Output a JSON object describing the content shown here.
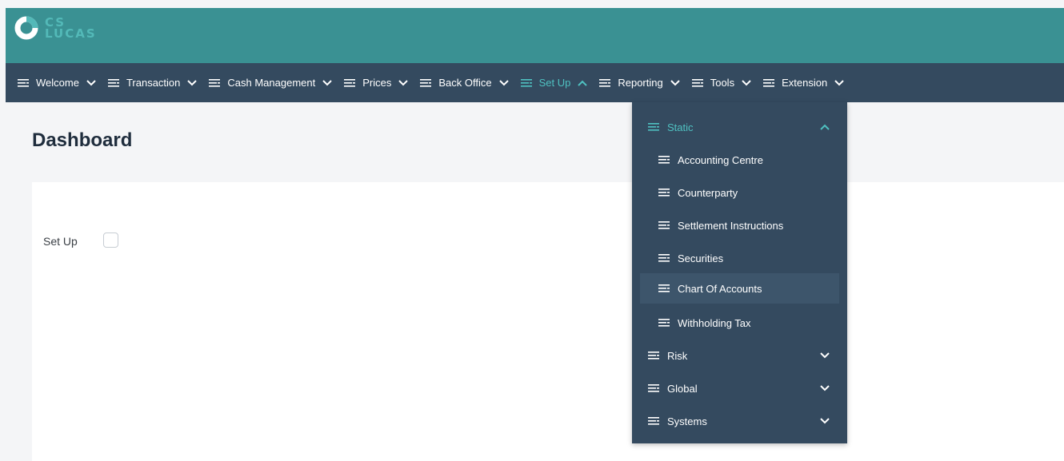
{
  "brand": {
    "logo_line1": "CS",
    "logo_line2": "LUCAS",
    "colors": {
      "header": "#3a9193",
      "navbar": "#344a5f",
      "accent": "#4fc1c1"
    }
  },
  "nav": {
    "items": [
      {
        "label": "Welcome",
        "icon": "menu-lines-icon",
        "chevron": "chevron-down-icon"
      },
      {
        "label": "Transaction",
        "icon": "menu-lines-icon",
        "chevron": "chevron-down-icon"
      },
      {
        "label": "Cash Management",
        "icon": "menu-lines-icon",
        "chevron": "chevron-down-icon"
      },
      {
        "label": "Prices",
        "icon": "menu-lines-icon",
        "chevron": "chevron-down-icon"
      },
      {
        "label": "Back Office",
        "icon": "menu-lines-icon",
        "chevron": "chevron-down-icon"
      },
      {
        "label": "Set Up",
        "icon": "menu-lines-icon",
        "chevron": "chevron-up-icon",
        "active": true
      },
      {
        "label": "Reporting",
        "icon": "menu-lines-icon",
        "chevron": "chevron-down-icon"
      },
      {
        "label": "Tools",
        "icon": "menu-lines-icon",
        "chevron": "chevron-down-icon"
      },
      {
        "label": "Extension",
        "icon": "menu-lines-icon",
        "chevron": "chevron-down-icon"
      }
    ]
  },
  "page": {
    "title": "Dashboard"
  },
  "form": {
    "setup_label": "Set Up",
    "setup_checked": false
  },
  "dropdown": {
    "static_label": "Static",
    "static_items": [
      {
        "label": "Accounting Centre"
      },
      {
        "label": "Counterparty"
      },
      {
        "label": "Settlement Instructions"
      },
      {
        "label": "Securities"
      },
      {
        "label": "Chart Of Accounts",
        "highlighted": true
      },
      {
        "label": "Withholding Tax"
      }
    ],
    "groups": [
      {
        "label": "Risk"
      },
      {
        "label": "Global"
      },
      {
        "label": "Systems"
      }
    ]
  }
}
